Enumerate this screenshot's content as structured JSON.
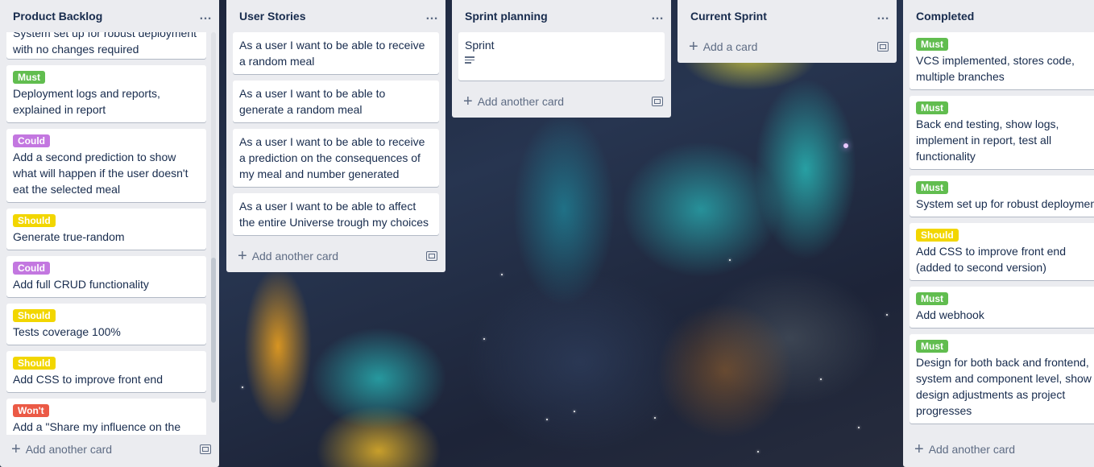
{
  "lists": [
    {
      "title": "Product Backlog",
      "cards": [
        {
          "label": "",
          "text": "System set up for robust deployment with no changes required"
        },
        {
          "label": "Must",
          "text": "Deployment logs and reports, explained in report"
        },
        {
          "label": "Could",
          "text": "Add a second prediction to show what will happen if the user doesn't eat the selected meal"
        },
        {
          "label": "Should",
          "text": "Generate true-random"
        },
        {
          "label": "Could",
          "text": "Add full CRUD functionality"
        },
        {
          "label": "Should",
          "text": "Tests coverage 100%"
        },
        {
          "label": "Should",
          "text": "Add CSS to improve front end"
        },
        {
          "label": "Won't",
          "text": "Add a \"Share my influence on the"
        }
      ],
      "add_label": "Add another card"
    },
    {
      "title": "User Stories",
      "cards": [
        {
          "text": "As a user I want to be able to receive a random meal"
        },
        {
          "text": "As a user I want to be able to generate a random meal"
        },
        {
          "text": "As a user I want to be able to receive a prediction on the consequences of my meal and number generated"
        },
        {
          "text": "As a user I want to be able to affect the entire Universe trough my choices"
        }
      ],
      "add_label": "Add another card"
    },
    {
      "title": "Sprint planning",
      "cards": [
        {
          "text": "Sprint"
        }
      ],
      "add_label": "Add another card"
    },
    {
      "title": "Current Sprint",
      "add_label": "Add a card"
    },
    {
      "title": "Completed",
      "cards": [
        {
          "label": "Must",
          "text": "VCS implemented, stores code, multiple branches"
        },
        {
          "label": "Must",
          "text": "Back end testing, show logs, implement in report, test all functionality"
        },
        {
          "label": "Must",
          "text": "System set up for robust deployment with no changes required"
        },
        {
          "label": "Should",
          "text": "Add CSS to improve front end (added to second version)"
        },
        {
          "label": "Must",
          "text": "Add webhook"
        },
        {
          "label": "Must",
          "text": "Design for both back and frontend, system and component level, show design adjustments as project progresses"
        }
      ],
      "add_label": "Add another card"
    }
  ],
  "menu_glyph": "…",
  "icons": {
    "list_menu": "ellipsis-icon",
    "add": "plus-icon",
    "template": "card-template-icon",
    "description": "description-icon"
  },
  "colors": {
    "must": "#61bd4f",
    "could": "#c377e0",
    "should": "#f2d600",
    "wont": "#eb5a46",
    "list_bg": "#ebecf0"
  }
}
